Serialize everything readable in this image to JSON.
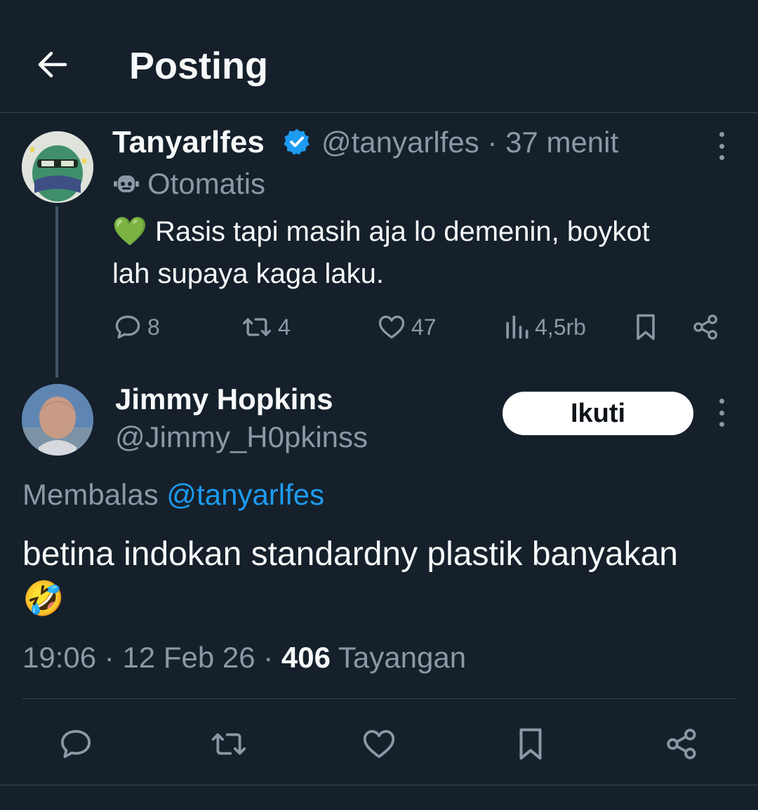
{
  "header": {
    "title": "Posting",
    "back_icon": "arrow-left-icon"
  },
  "parent_tweet": {
    "name": "Tanyarlfes",
    "verified": true,
    "handle": "@tanyarlfes",
    "separator": "·",
    "time": "37 menit",
    "automated_label": "Otomatis",
    "text_emoji": "💚",
    "text": "Rasis tapi masih aja lo demenin, boykot lah supaya kaga laku.",
    "stats": {
      "replies": "8",
      "reposts": "4",
      "likes": "47",
      "views": "4,5rb"
    }
  },
  "reply_tweet": {
    "name": "Jimmy Hopkins",
    "handle": "@Jimmy_H0pkinss",
    "follow_label": "Ikuti",
    "replying_prefix": "Membalas",
    "replying_to": "@tanyarlfes",
    "text": "betina indokan standardny plastik banyakan",
    "text_emoji": "🤣",
    "time": "19:06",
    "date": "12 Feb 26",
    "views_count": "406",
    "views_label": "Tayangan"
  },
  "colors": {
    "background": "#15202b",
    "muted": "#8b98a5",
    "accent": "#1d9bf0",
    "text": "#f7f9f9"
  }
}
